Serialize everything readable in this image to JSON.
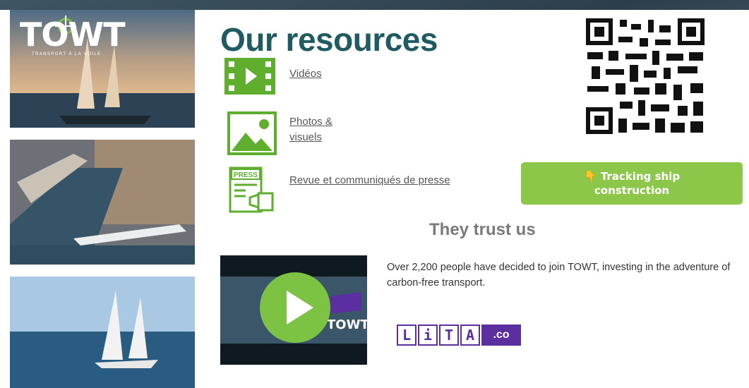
{
  "logo": {
    "brand": "TOWT",
    "tagline": "TRANSPORT À LA VOILE"
  },
  "resources": {
    "title": "Our resources",
    "videos_label": "Vidéos",
    "photos_label": "Photos & visuels",
    "press_label": "Revue et communiqués de presse",
    "press_icon_text": "PRESS"
  },
  "tracking_button": {
    "icon": "👇",
    "label": "Tracking ship construction"
  },
  "trust": {
    "title": "They trust us",
    "description": "Over 2,200 people have decided to join TOWT, investing in the adventure of carbon-free transport.",
    "video_brand": "TOWT",
    "partner": {
      "letters": [
        "L",
        "i",
        "T",
        "A"
      ],
      "suffix": ".co"
    }
  },
  "colors": {
    "accent_green": "#8cc74a",
    "title_teal": "#1f5b61",
    "lita_purple": "#5b2fa0"
  }
}
